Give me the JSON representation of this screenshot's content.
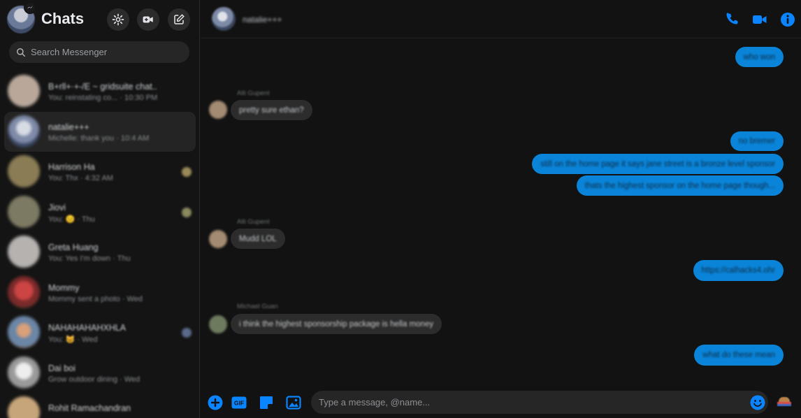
{
  "sidebar": {
    "title": "Chats",
    "search_placeholder": "Search Messenger",
    "chats": [
      {
        "name": "B+rll+·+-/E ~ gridsuite chat..",
        "preview": "You: reinstating co... · 10:30 PM",
        "avatar": "#b9a89a"
      },
      {
        "name": "natalie+++",
        "preview": "Michelle: thank you · 10:4 AM",
        "avatar": "#8b97b0"
      },
      {
        "name": "Harrison Ha",
        "preview": "You: Thx · 4:32 AM",
        "avatar": "#8a7d55"
      },
      {
        "name": "Jiovi",
        "preview": "You: 😐 · Thu",
        "avatar": "#7c7a62"
      },
      {
        "name": "Greta Huang",
        "preview": "You: Yes I'm down · Thu",
        "avatar": "#b5b2b0"
      },
      {
        "name": "Mommy",
        "preview": "Mommy sent a photo · Wed",
        "avatar": "#9b3434"
      },
      {
        "name": "NAHAHAHAHXHLA",
        "preview": "You: 😺 · Wed",
        "avatar": "#6b86a6"
      },
      {
        "name": "Dai boi",
        "preview": "Grow outdoor dining · Wed",
        "avatar": "#c9c9c9"
      },
      {
        "name": "Rohit Ramachandran",
        "preview": "",
        "avatar": "#c7a57a"
      }
    ]
  },
  "conversation": {
    "name": "natalie+++",
    "messages": [
      {
        "dir": "out",
        "text": "who won"
      },
      {
        "dir": "in",
        "sender": "Alli Gupent",
        "text": "pretty sure ethan?"
      },
      {
        "dir": "out",
        "text": "no bremer"
      },
      {
        "dir": "out",
        "text": "still on the home page it says jane street is a bronze level sponsor"
      },
      {
        "dir": "out",
        "text": "thats the highest sponsor on the home page though..."
      },
      {
        "dir": "in",
        "sender": "Alli Gupent",
        "text": "Mudd LOL"
      },
      {
        "dir": "out",
        "text": "https://calhacks4.ohr"
      },
      {
        "dir": "in",
        "sender": "Michael Guan",
        "text": "i think the highest sponsorship package is hella money"
      },
      {
        "dir": "out",
        "text": "what do these mean"
      }
    ]
  },
  "composer": {
    "placeholder": "Type a message, @name..."
  },
  "colors": {
    "accent": "#0a84ff",
    "outgoing_bubble": "#0a84d8",
    "incoming_bubble": "#2c2c2c",
    "background": "#121212"
  }
}
